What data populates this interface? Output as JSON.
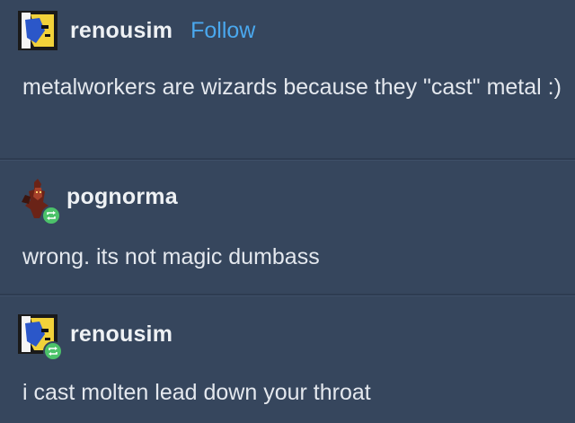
{
  "posts": [
    {
      "username": "renousim",
      "follow_label": "Follow",
      "text": "metalworkers are wizards because they \"cast\" metal :)",
      "avatar": "renousim-avatar",
      "reblog": false
    },
    {
      "username": "pognorma",
      "text": "wrong. its not magic dumbass",
      "avatar": "pognorma-avatar",
      "reblog": true
    },
    {
      "username": "renousim",
      "text": "i cast molten lead down your throat",
      "avatar": "renousim-avatar",
      "reblog": true
    }
  ],
  "colors": {
    "background": "#36465d",
    "follow": "#4aa8ee",
    "reblog_badge": "#4cc26a"
  }
}
